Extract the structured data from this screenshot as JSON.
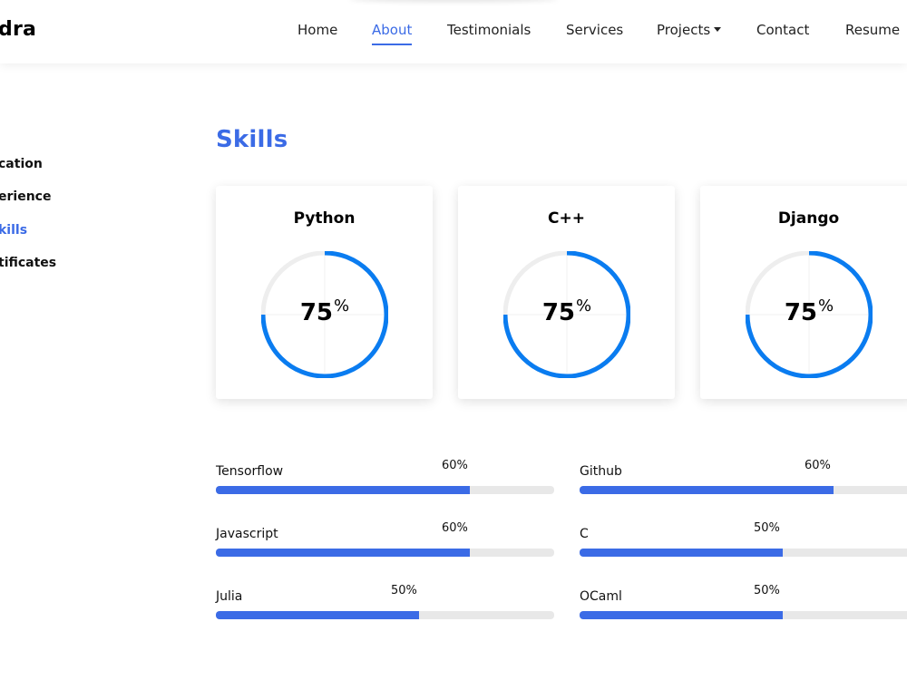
{
  "brand": "dra",
  "nav": {
    "items": [
      {
        "label": "Home",
        "active": false
      },
      {
        "label": "About",
        "active": true
      },
      {
        "label": "Testimonials",
        "active": false
      },
      {
        "label": "Services",
        "active": false
      },
      {
        "label": "Projects",
        "active": false,
        "dropdown": true
      },
      {
        "label": "Contact",
        "active": false
      },
      {
        "label": "Resume",
        "active": false
      }
    ]
  },
  "sidebar": {
    "items": [
      {
        "label": "cation",
        "active": false
      },
      {
        "label": "erience",
        "active": false
      },
      {
        "label": "kills",
        "active": true
      },
      {
        "label": "tificates",
        "active": false
      }
    ]
  },
  "skills": {
    "title": "Skills",
    "cards": [
      {
        "name": "Python",
        "value": "75",
        "unit": "%",
        "percent": 75
      },
      {
        "name": "C++",
        "value": "75",
        "unit": "%",
        "percent": 75
      },
      {
        "name": "Django",
        "value": "75",
        "unit": "%",
        "percent": 75
      }
    ],
    "bars": [
      {
        "label": "Tensorflow",
        "pct_label": "60%",
        "percent": 75
      },
      {
        "label": "Github",
        "pct_label": "60%",
        "percent": 75
      },
      {
        "label": "Javascript",
        "pct_label": "60%",
        "percent": 75
      },
      {
        "label": "C",
        "pct_label": "50%",
        "percent": 60
      },
      {
        "label": "Julia",
        "pct_label": "50%",
        "percent": 60
      },
      {
        "label": "OCaml",
        "pct_label": "50%",
        "percent": 60
      }
    ]
  },
  "colors": {
    "accent": "#3b6be6",
    "ring": "#0a7cf0",
    "ring_track": "#eeeeee",
    "bar_track": "#e8e8e8"
  }
}
